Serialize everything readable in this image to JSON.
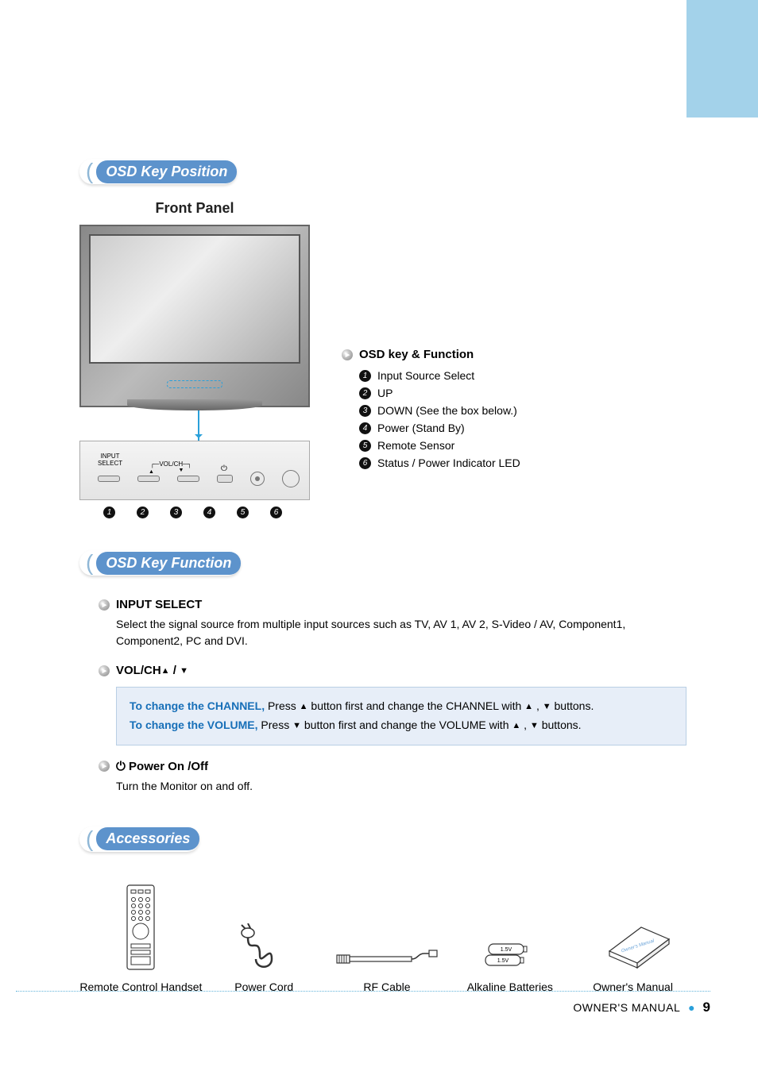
{
  "headings": {
    "osd_key_position": "OSD Key Position",
    "front_panel": "Front Panel",
    "osd_key_function_title": "OSD key & Function",
    "osd_key_function_section": "OSD Key Function",
    "accessories": "Accessories"
  },
  "button_panel": {
    "input_select": "INPUT\nSELECT",
    "volch": "VOL/CH"
  },
  "osd_functions": [
    {
      "num": "1",
      "label": "Input Source Select"
    },
    {
      "num": "2",
      "label": "UP"
    },
    {
      "num": "3",
      "label": "DOWN (See the box below.)"
    },
    {
      "num": "4",
      "label": "Power (Stand By)"
    },
    {
      "num": "5",
      "label": "Remote Sensor"
    },
    {
      "num": "6",
      "label": "Status / Power Indicator LED"
    }
  ],
  "input_select": {
    "title": "INPUT SELECT",
    "body": "Select the signal source from multiple input sources such as TV, AV 1, AV 2, S-Video / AV, Component1, Component2,  PC and DVI."
  },
  "volch": {
    "title": "VOL/CH",
    "box": {
      "channel_prefix": "To change the CHANNEL,",
      "channel_rest_a": " Press ",
      "channel_rest_b": " button first and change the CHANNEL with ",
      "channel_rest_c": " buttons.",
      "volume_prefix": "To change the VOLUME,",
      "volume_rest_a": " Press ",
      "volume_rest_b": " button first and change the VOLUME with ",
      "volume_rest_c": " buttons."
    }
  },
  "power": {
    "title": "Power On /Off",
    "body": "Turn the Monitor on and off."
  },
  "accessories_items": [
    "Remote Control Handset",
    "Power Cord",
    "RF Cable",
    "Alkaline Batteries",
    "Owner's Manual"
  ],
  "battery_label": "1.5V",
  "manual_icon_text": "Owner's Manual",
  "footer": {
    "manual": "OWNER'S MANUAL",
    "page": "9"
  }
}
